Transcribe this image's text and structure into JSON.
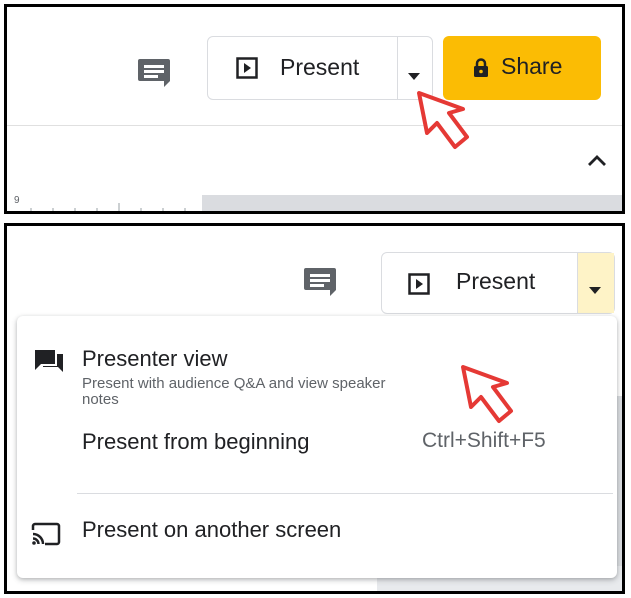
{
  "top_panel": {
    "present_label": "Present",
    "share_label": "Share",
    "ruler_number": "9"
  },
  "bottom_panel": {
    "present_label": "Present",
    "menu": {
      "items": [
        {
          "label": "Presenter view",
          "description": "Present with audience Q&A and view speaker notes",
          "icon": "presenter-view-icon"
        },
        {
          "label": "Present from beginning",
          "shortcut": "Ctrl+Shift+F5"
        },
        {
          "label": "Present on another screen",
          "icon": "cast-icon"
        }
      ]
    }
  },
  "colors": {
    "share_button": "#fbbc04",
    "cursor_outline": "#e53935"
  }
}
